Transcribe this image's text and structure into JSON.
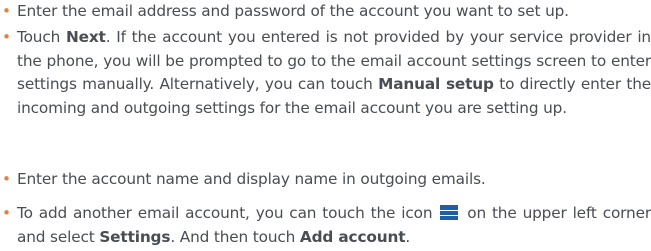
{
  "bullet_glyph": "•",
  "bullet_color": "#f07a3e",
  "text_color": "#4a4d52",
  "icon_color": "#1e5fa8",
  "steps": [
    {
      "text": "Enter the email address and password of the account you want to set up."
    },
    {
      "pre": "Touch ",
      "bold1": "Next",
      "mid": ". If the account you entered is not provided by your service provider in the phone, you will be prompted to go to the email account settings screen to enter settings manually. Alternatively, you can touch ",
      "bold2": "Manual setup",
      "post": " to directly enter the incoming and outgoing settings for the email account you are setting up."
    },
    {
      "text": "Enter the account name and display name in outgoing emails."
    },
    {
      "pre": "To add another email account, you can touch the icon ",
      "icon": "menu-icon",
      "mid": " on the upper left corner and select ",
      "bold1": "Settings",
      "mid2": ". And then touch ",
      "bold2": "Add account",
      "post": "."
    }
  ]
}
